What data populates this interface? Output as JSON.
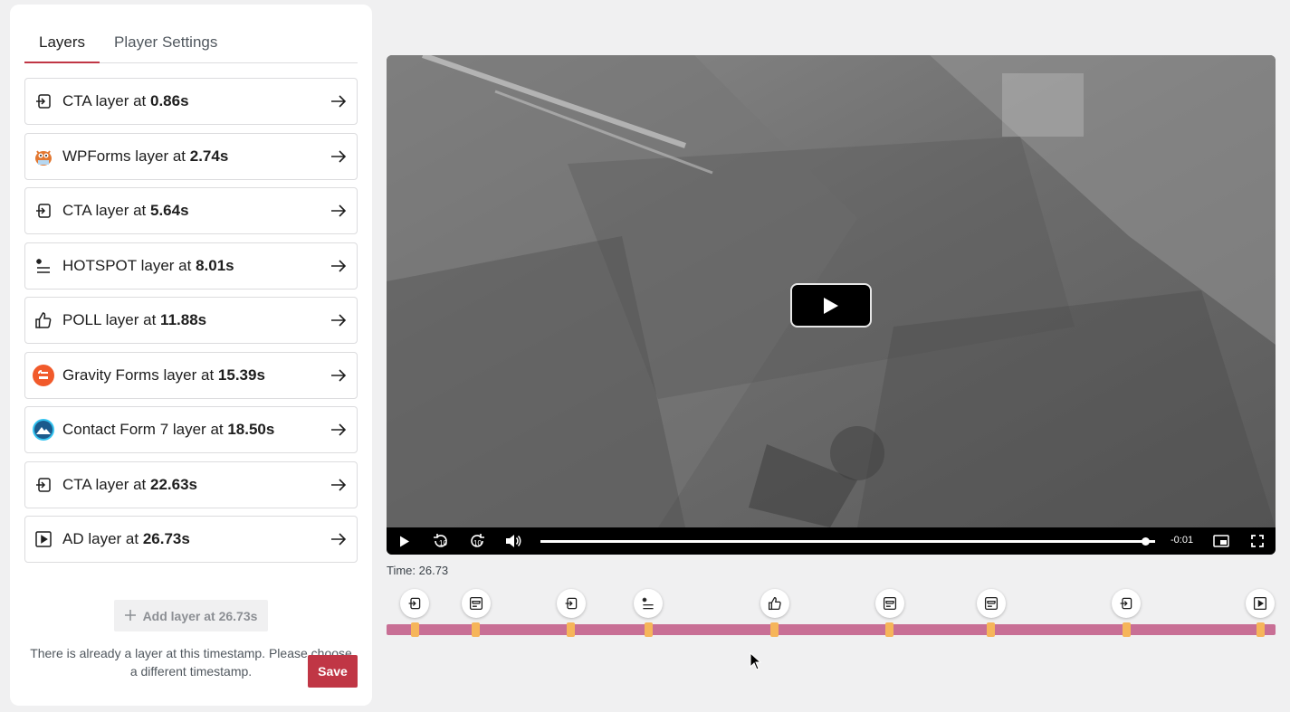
{
  "tabs": {
    "layers": "Layers",
    "player_settings": "Player Settings"
  },
  "layers": [
    {
      "name": "CTA layer at ",
      "time": "0.86s",
      "icon": "cta-icon"
    },
    {
      "name": "WPForms layer at ",
      "time": "2.74s",
      "icon": "wpforms-icon"
    },
    {
      "name": "CTA layer at ",
      "time": "5.64s",
      "icon": "cta-icon"
    },
    {
      "name": "HOTSPOT layer at ",
      "time": "8.01s",
      "icon": "hotspot-icon"
    },
    {
      "name": "POLL layer at ",
      "time": "11.88s",
      "icon": "thumbs-up-icon"
    },
    {
      "name": "Gravity Forms layer at ",
      "time": "15.39s",
      "icon": "gravity-forms-icon"
    },
    {
      "name": "Contact Form 7 layer at ",
      "time": "18.50s",
      "icon": "contact-form-7-icon"
    },
    {
      "name": "CTA layer at ",
      "time": "22.63s",
      "icon": "cta-icon"
    },
    {
      "name": "AD layer at ",
      "time": "26.73s",
      "icon": "ad-play-icon"
    }
  ],
  "add_layer": {
    "label": "Add layer at 26.73s"
  },
  "notice": "There is already a layer at this timestamp. Please choose a different timestamp.",
  "save_label": "Save",
  "player": {
    "remaining": "-0:01",
    "progress": 0.99
  },
  "time_label": "Time: 26.73",
  "timeline": {
    "duration_s": 27.2,
    "markers": [
      {
        "time": 0.86,
        "icon": "cta-icon"
      },
      {
        "time": 2.74,
        "icon": "form-icon"
      },
      {
        "time": 5.64,
        "icon": "cta-icon"
      },
      {
        "time": 8.01,
        "icon": "hotspot-icon"
      },
      {
        "time": 11.88,
        "icon": "thumbs-up-icon"
      },
      {
        "time": 15.39,
        "icon": "form-icon"
      },
      {
        "time": 18.5,
        "icon": "form-icon"
      },
      {
        "time": 22.63,
        "icon": "cta-icon"
      },
      {
        "time": 26.73,
        "icon": "ad-play-icon"
      }
    ]
  },
  "colors": {
    "accent": "#c03645",
    "timeline_track": "#c86f95",
    "timeline_marker": "#f6b55a"
  }
}
